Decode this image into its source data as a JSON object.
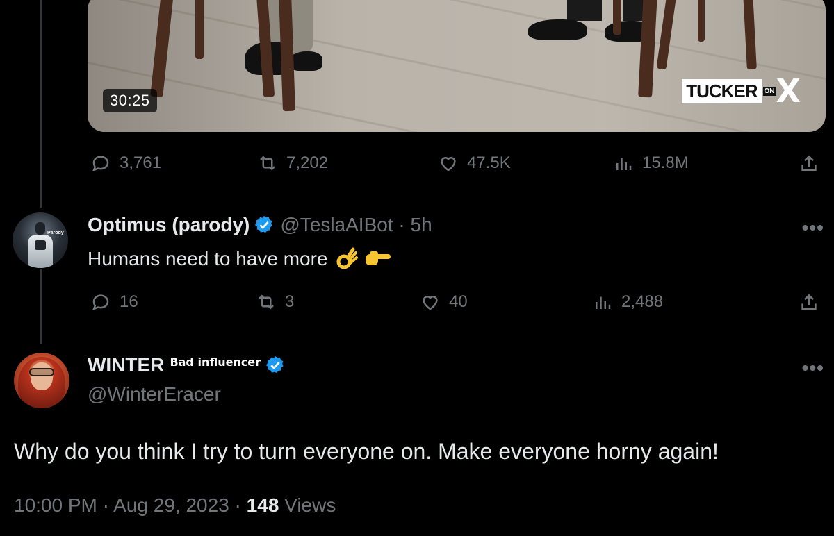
{
  "video": {
    "duration": "30:25",
    "watermark": {
      "main": "TUCKER",
      "on": "ON",
      "x": "X"
    }
  },
  "parent_tweet": {
    "stats": {
      "replies": "3,761",
      "reposts": "7,202",
      "likes": "47.5K",
      "views": "15.8M"
    }
  },
  "reply_tweet": {
    "author_name": "Optimus (parody)",
    "avatar_tag": "Parody",
    "handle_time": "@TeslaAIBot · 5h",
    "text": "Humans need to have more",
    "emojis": [
      "ok-hand-emoji",
      "pointing-right-emoji"
    ],
    "stats": {
      "replies": "16",
      "reposts": "3",
      "likes": "40",
      "views": "2,488"
    }
  },
  "main_tweet": {
    "author_name": "WINTER",
    "author_badge": "Bad influencer",
    "handle": "@WinterEracer",
    "text": "Why do you think I try to turn everyone on. Make everyone horny again!",
    "time": "10:00 PM · Aug 29, 2023 · ",
    "views_count": "148",
    "views_label": " Views"
  },
  "more_label": "•••",
  "colors": {
    "background": "#000000",
    "text_primary": "#e7e9ea",
    "text_secondary": "#71767b",
    "verified_blue": "#1d9bf0",
    "thread_line": "#333639"
  }
}
